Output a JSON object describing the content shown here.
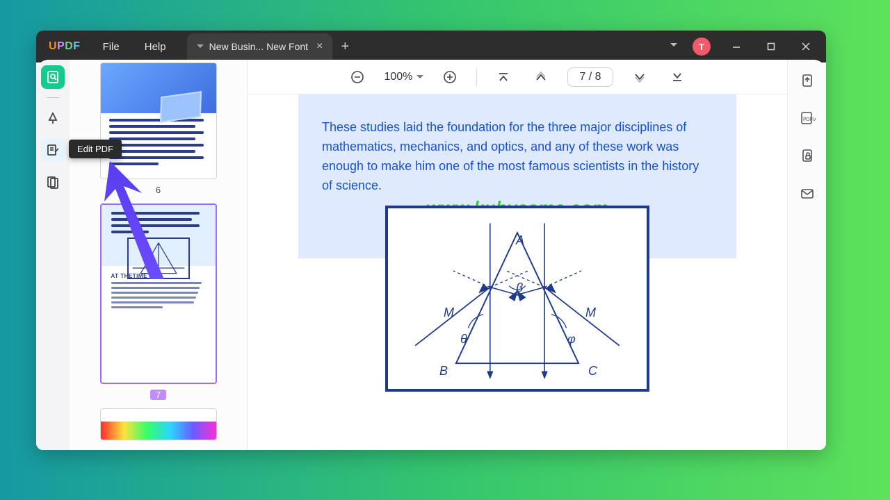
{
  "app": {
    "logo_u": "U",
    "logo_p": "P",
    "logo_d": "D",
    "logo_f": "F"
  },
  "menu": {
    "file": "File",
    "help": "Help"
  },
  "tab": {
    "title": "New Busin... New Font"
  },
  "avatar": {
    "initial": "T"
  },
  "rail": {
    "tooltip_edit": "Edit PDF"
  },
  "thumbs": {
    "p6_label": "6",
    "p7_label": "7",
    "p7_heading": "AT THETIME"
  },
  "toolbar": {
    "zoom": "100%",
    "page_indicator": "7 / 8"
  },
  "page": {
    "paragraph": "These studies laid the foundation for the three major disciplines of mathematics, mechanics, and optics, and any of these work was enough to make him one of the most famous scientists in the history of science.",
    "watermark": "www.kuhyaame.com",
    "labels": {
      "A": "A",
      "B": "B",
      "C": "C",
      "M1": "M",
      "M2": "M",
      "beta": "β",
      "theta": "θ",
      "phi": "φ"
    }
  }
}
